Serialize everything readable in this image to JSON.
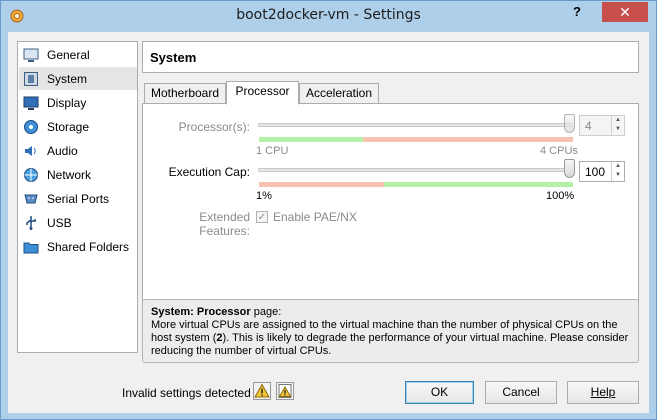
{
  "window": {
    "title": "boot2docker-vm - Settings",
    "help_glyph": "?",
    "close_glyph": "✕"
  },
  "sidebar": {
    "items": [
      {
        "label": "General",
        "icon": "general-icon"
      },
      {
        "label": "System",
        "icon": "system-icon",
        "selected": true
      },
      {
        "label": "Display",
        "icon": "display-icon"
      },
      {
        "label": "Storage",
        "icon": "storage-icon"
      },
      {
        "label": "Audio",
        "icon": "audio-icon"
      },
      {
        "label": "Network",
        "icon": "network-icon"
      },
      {
        "label": "Serial Ports",
        "icon": "serial-ports-icon"
      },
      {
        "label": "USB",
        "icon": "usb-icon"
      },
      {
        "label": "Shared Folders",
        "icon": "shared-folders-icon"
      }
    ]
  },
  "section": {
    "title": "System"
  },
  "tabs": [
    {
      "label": "Motherboard",
      "active": false
    },
    {
      "label": "Processor",
      "active": true
    },
    {
      "label": "Acceleration",
      "active": false
    }
  ],
  "processor": {
    "processors_label": "Processor(s):",
    "processors_value": "4",
    "processors_min_label": "1 CPU",
    "processors_max_label": "4 CPUs",
    "exec_cap_label": "Execution Cap:",
    "exec_cap_value": "100",
    "exec_cap_min_label": "1%",
    "exec_cap_max_label": "100%",
    "extended_label": "Extended Features:",
    "pae_label": "Enable PAE/NX",
    "pae_checked": true
  },
  "info": {
    "heading": "System: Processor",
    "heading_suffix": " page:",
    "line1": "More virtual CPUs are assigned to the virtual machine than the number of physical CPUs on the",
    "line2_a": "host system (",
    "line2_b": "2",
    "line2_c": "). This is likely to degrade the performance of your virtual machine. Please consider",
    "line3": "reducing the number of virtual CPUs."
  },
  "footer": {
    "invalid_text": "Invalid settings detected",
    "ok_label": "OK",
    "cancel_label": "Cancel",
    "help_label": "Help"
  },
  "colors": {
    "green_band": "#b3f0a8",
    "red_band": "#f7c3b0",
    "titlebar": "#aecfea",
    "close_button": "#c7504c"
  }
}
